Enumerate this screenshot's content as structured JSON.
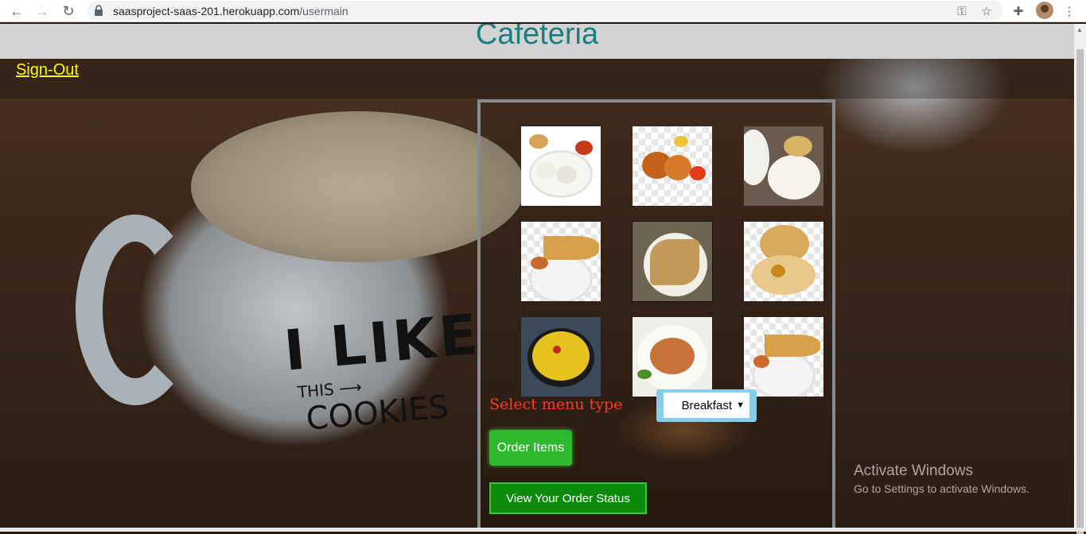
{
  "browser": {
    "url_host": "saasproject-saas-201.herokuapp.com",
    "url_path": "/usermain",
    "icons": [
      "back-arrow-icon",
      "forward-arrow-icon",
      "reload-icon",
      "lock-icon",
      "key-icon",
      "star-icon",
      "extensions-icon",
      "profile-avatar",
      "kebab-menu-icon"
    ]
  },
  "header": {
    "title": "Cafeteria"
  },
  "nav": {
    "signout": "Sign-Out"
  },
  "menu": {
    "label": "Select menu type",
    "selected": "Breakfast"
  },
  "actions": {
    "order": "Order Items",
    "status": "View Your Order Status"
  },
  "watermark": {
    "line1": "Activate Windows",
    "line2": "Go to Settings to activate Windows."
  },
  "colors": {
    "title": "#1a7f7f",
    "signout": "#ffff00",
    "menu_label": "#ff3b1f",
    "order_button": "#2db82d",
    "status_button": "#0b8a0b",
    "select_frame": "#87ceeb"
  }
}
